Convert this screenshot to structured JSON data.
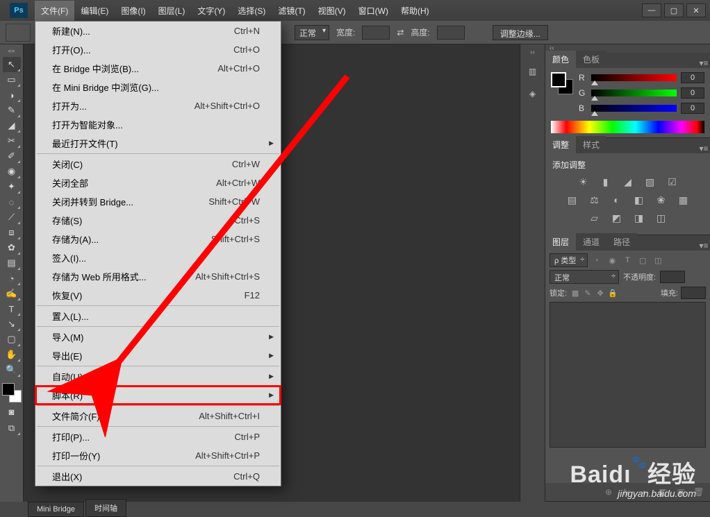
{
  "app": {
    "logo": "Ps"
  },
  "menubar": [
    "文件(F)",
    "编辑(E)",
    "图像(I)",
    "图层(L)",
    "文字(Y)",
    "选择(S)",
    "滤镜(T)",
    "视图(V)",
    "窗口(W)",
    "帮助(H)"
  ],
  "win_controls": {
    "min": "—",
    "max": "▢",
    "close": "✕"
  },
  "optionsbar": {
    "blend_label": "正常",
    "width_label": "宽度:",
    "height_label": "高度:",
    "swap_icon": "⇄",
    "refine_edge": "调整边缘..."
  },
  "tools": [
    "↖",
    "▭",
    "◑",
    "✎",
    "◢",
    "✂",
    "✐",
    "◉",
    "✦",
    "◌",
    "⟋",
    "⧈",
    "✿",
    "▤",
    "◔",
    "✍",
    "T",
    "↘",
    "▢",
    "✋",
    "🔍"
  ],
  "file_menu": {
    "groups": [
      [
        {
          "label": "新建(N)...",
          "shortcut": "Ctrl+N"
        },
        {
          "label": "打开(O)...",
          "shortcut": "Ctrl+O"
        },
        {
          "label": "在 Bridge 中浏览(B)...",
          "shortcut": "Alt+Ctrl+O"
        },
        {
          "label": "在 Mini Bridge 中浏览(G)..."
        },
        {
          "label": "打开为...",
          "shortcut": "Alt+Shift+Ctrl+O"
        },
        {
          "label": "打开为智能对象..."
        },
        {
          "label": "最近打开文件(T)",
          "submenu": true
        }
      ],
      [
        {
          "label": "关闭(C)",
          "shortcut": "Ctrl+W"
        },
        {
          "label": "关闭全部",
          "shortcut": "Alt+Ctrl+W"
        },
        {
          "label": "关闭并转到 Bridge...",
          "shortcut": "Shift+Ctrl+W"
        },
        {
          "label": "存储(S)",
          "shortcut": "Ctrl+S"
        },
        {
          "label": "存储为(A)...",
          "shortcut": "Shift+Ctrl+S"
        },
        {
          "label": "签入(I)..."
        },
        {
          "label": "存储为 Web 所用格式...",
          "shortcut": "Alt+Shift+Ctrl+S"
        },
        {
          "label": "恢复(V)",
          "shortcut": "F12"
        }
      ],
      [
        {
          "label": "置入(L)..."
        }
      ],
      [
        {
          "label": "导入(M)",
          "submenu": true
        },
        {
          "label": "导出(E)",
          "submenu": true
        }
      ],
      [
        {
          "label": "自动(U)",
          "submenu": true
        },
        {
          "label": "脚本(R)",
          "submenu": true,
          "highlight": true
        }
      ],
      [
        {
          "label": "文件简介(F)...",
          "shortcut": "Alt+Shift+Ctrl+I"
        }
      ],
      [
        {
          "label": "打印(P)...",
          "shortcut": "Ctrl+P"
        },
        {
          "label": "打印一份(Y)",
          "shortcut": "Alt+Shift+Ctrl+P"
        }
      ],
      [
        {
          "label": "退出(X)",
          "shortcut": "Ctrl+Q"
        }
      ]
    ]
  },
  "panels": {
    "color": {
      "tabs": [
        "颜色",
        "色板"
      ],
      "channels": [
        {
          "name": "R",
          "value": "0"
        },
        {
          "name": "G",
          "value": "0"
        },
        {
          "name": "B",
          "value": "0"
        }
      ]
    },
    "adjustments": {
      "tabs": [
        "调整",
        "样式"
      ],
      "title": "添加调整",
      "row1": [
        "☀",
        "▮",
        "◢",
        "▨",
        "☑"
      ],
      "row2": [
        "▤",
        "⚖",
        "◐",
        "◧",
        "❀",
        "▦"
      ],
      "row3": [
        "▱",
        "◩",
        "◨",
        "◫"
      ]
    },
    "layers": {
      "tabs": [
        "图层",
        "通道",
        "路径"
      ],
      "kind": "ρ 类型",
      "filter_icons": [
        "▫",
        "◉",
        "T",
        "▢",
        "◫"
      ],
      "blend": "正常",
      "opacity_label": "不透明度:",
      "lock_label": "锁定:",
      "lock_icons": [
        "▩",
        "✎",
        "✥",
        "🔒"
      ],
      "fill_label": "填充:",
      "footer_icons": [
        "⊕",
        "fx",
        "◐",
        "◧",
        "▣",
        "🗑"
      ]
    }
  },
  "dock_icons": [
    "▥",
    "◈"
  ],
  "bottom_tabs": [
    "Mini Bridge",
    "时间轴"
  ],
  "watermark": {
    "brand": "Baidı",
    "suffix": "经验",
    "url": "jingyan.baidu.com"
  }
}
